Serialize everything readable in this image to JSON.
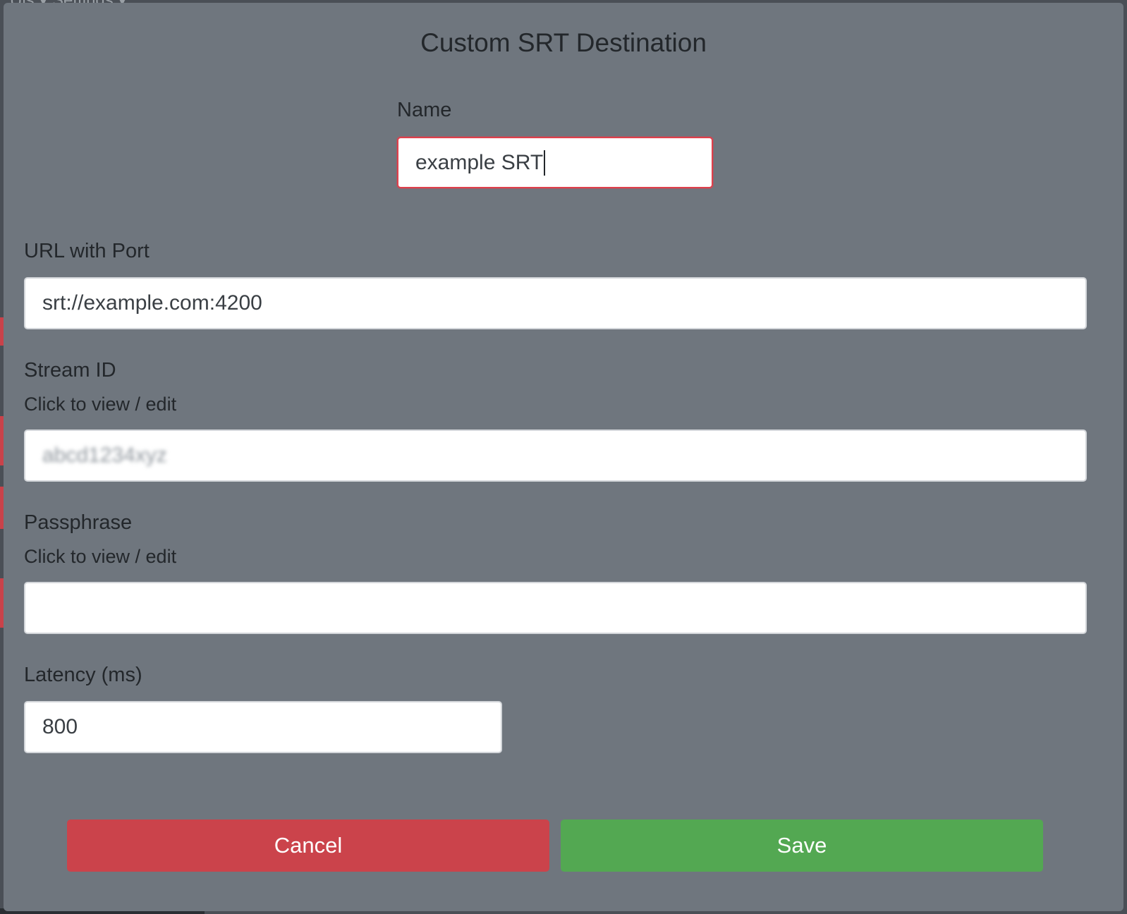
{
  "background": {
    "menu_text": "Uls ▾    Settings ▾"
  },
  "dialog": {
    "title": "Custom SRT Destination",
    "fields": {
      "name": {
        "label": "Name",
        "value": "example SRT"
      },
      "url": {
        "label": "URL with Port",
        "value": "srt://example.com:4200"
      },
      "stream_id": {
        "label": "Stream ID",
        "hint": "Click to view / edit",
        "value": "abcd1234xyz"
      },
      "passphrase": {
        "label": "Passphrase",
        "hint": "Click to view / edit",
        "value": ""
      },
      "latency": {
        "label": "Latency (ms)",
        "value": "800"
      }
    },
    "buttons": {
      "cancel": "Cancel",
      "save": "Save"
    }
  },
  "colors": {
    "modal_bg": "#6f767e",
    "cancel": "#cb434b",
    "save": "#53a852",
    "focus_border": "#e0404c"
  }
}
